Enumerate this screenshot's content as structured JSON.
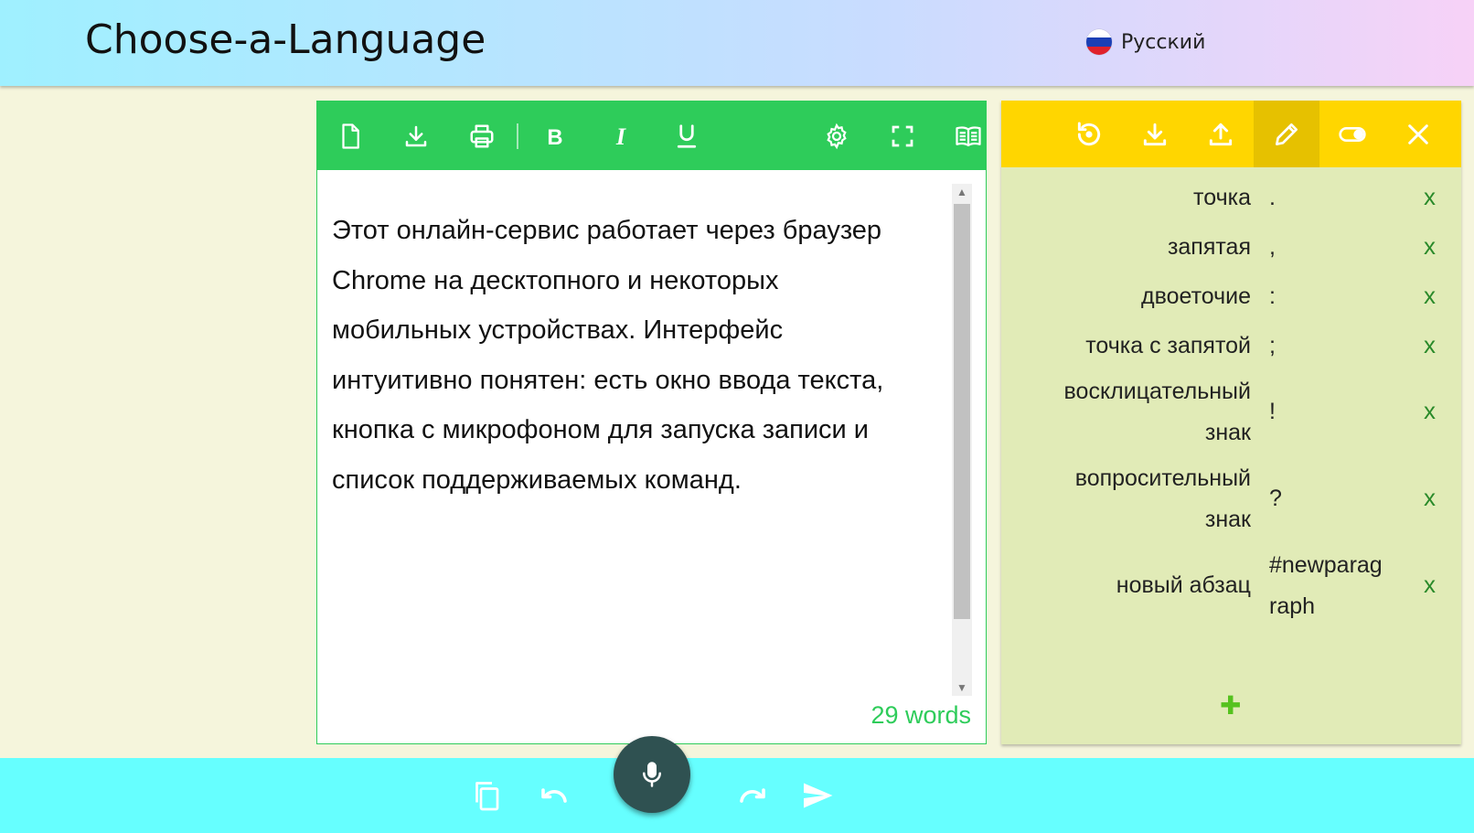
{
  "header": {
    "app_title": "Choose-a-Language",
    "language": "Русский"
  },
  "editor": {
    "toolbar_icons": [
      "new-document",
      "download",
      "print",
      "bold",
      "italic",
      "underline",
      "settings",
      "fullscreen",
      "reader-view"
    ],
    "text_lines": [
      "Этот онлайн-сервис работает через браузер",
      "Chrome на десктопного и некоторых",
      "мобильных устройствах. Интерфейс",
      "интуитивно понятен: есть окно ввода текста,",
      "кнопка с микрофоном для запуска записи и",
      "список поддерживаемых команд."
    ],
    "word_count": "29 words"
  },
  "commands": {
    "toolbar_icons": [
      "restore",
      "download",
      "upload",
      "edit",
      "toggle",
      "close"
    ],
    "delete_label": "x",
    "add_label": "✚",
    "items": [
      {
        "name": "точка",
        "value": "."
      },
      {
        "name": "запятая",
        "value": ","
      },
      {
        "name": "двоеточие",
        "value": ":"
      },
      {
        "name": "точка с запятой",
        "value": ";"
      },
      {
        "name": "восклицательный знак",
        "value": "!"
      },
      {
        "name": "вопросительный знак",
        "value": "?"
      },
      {
        "name": "новый абзац",
        "value": "#newparagraph"
      }
    ]
  },
  "bottom_bar": {
    "icons": [
      "copy",
      "undo",
      "microphone",
      "redo",
      "send"
    ]
  },
  "colors": {
    "editor_accent": "#2ecc5a",
    "commands_accent": "#ffd600",
    "commands_background": "#e1ebb7",
    "bottom_bar": "#66ffff",
    "mic_button": "#2f5151"
  }
}
